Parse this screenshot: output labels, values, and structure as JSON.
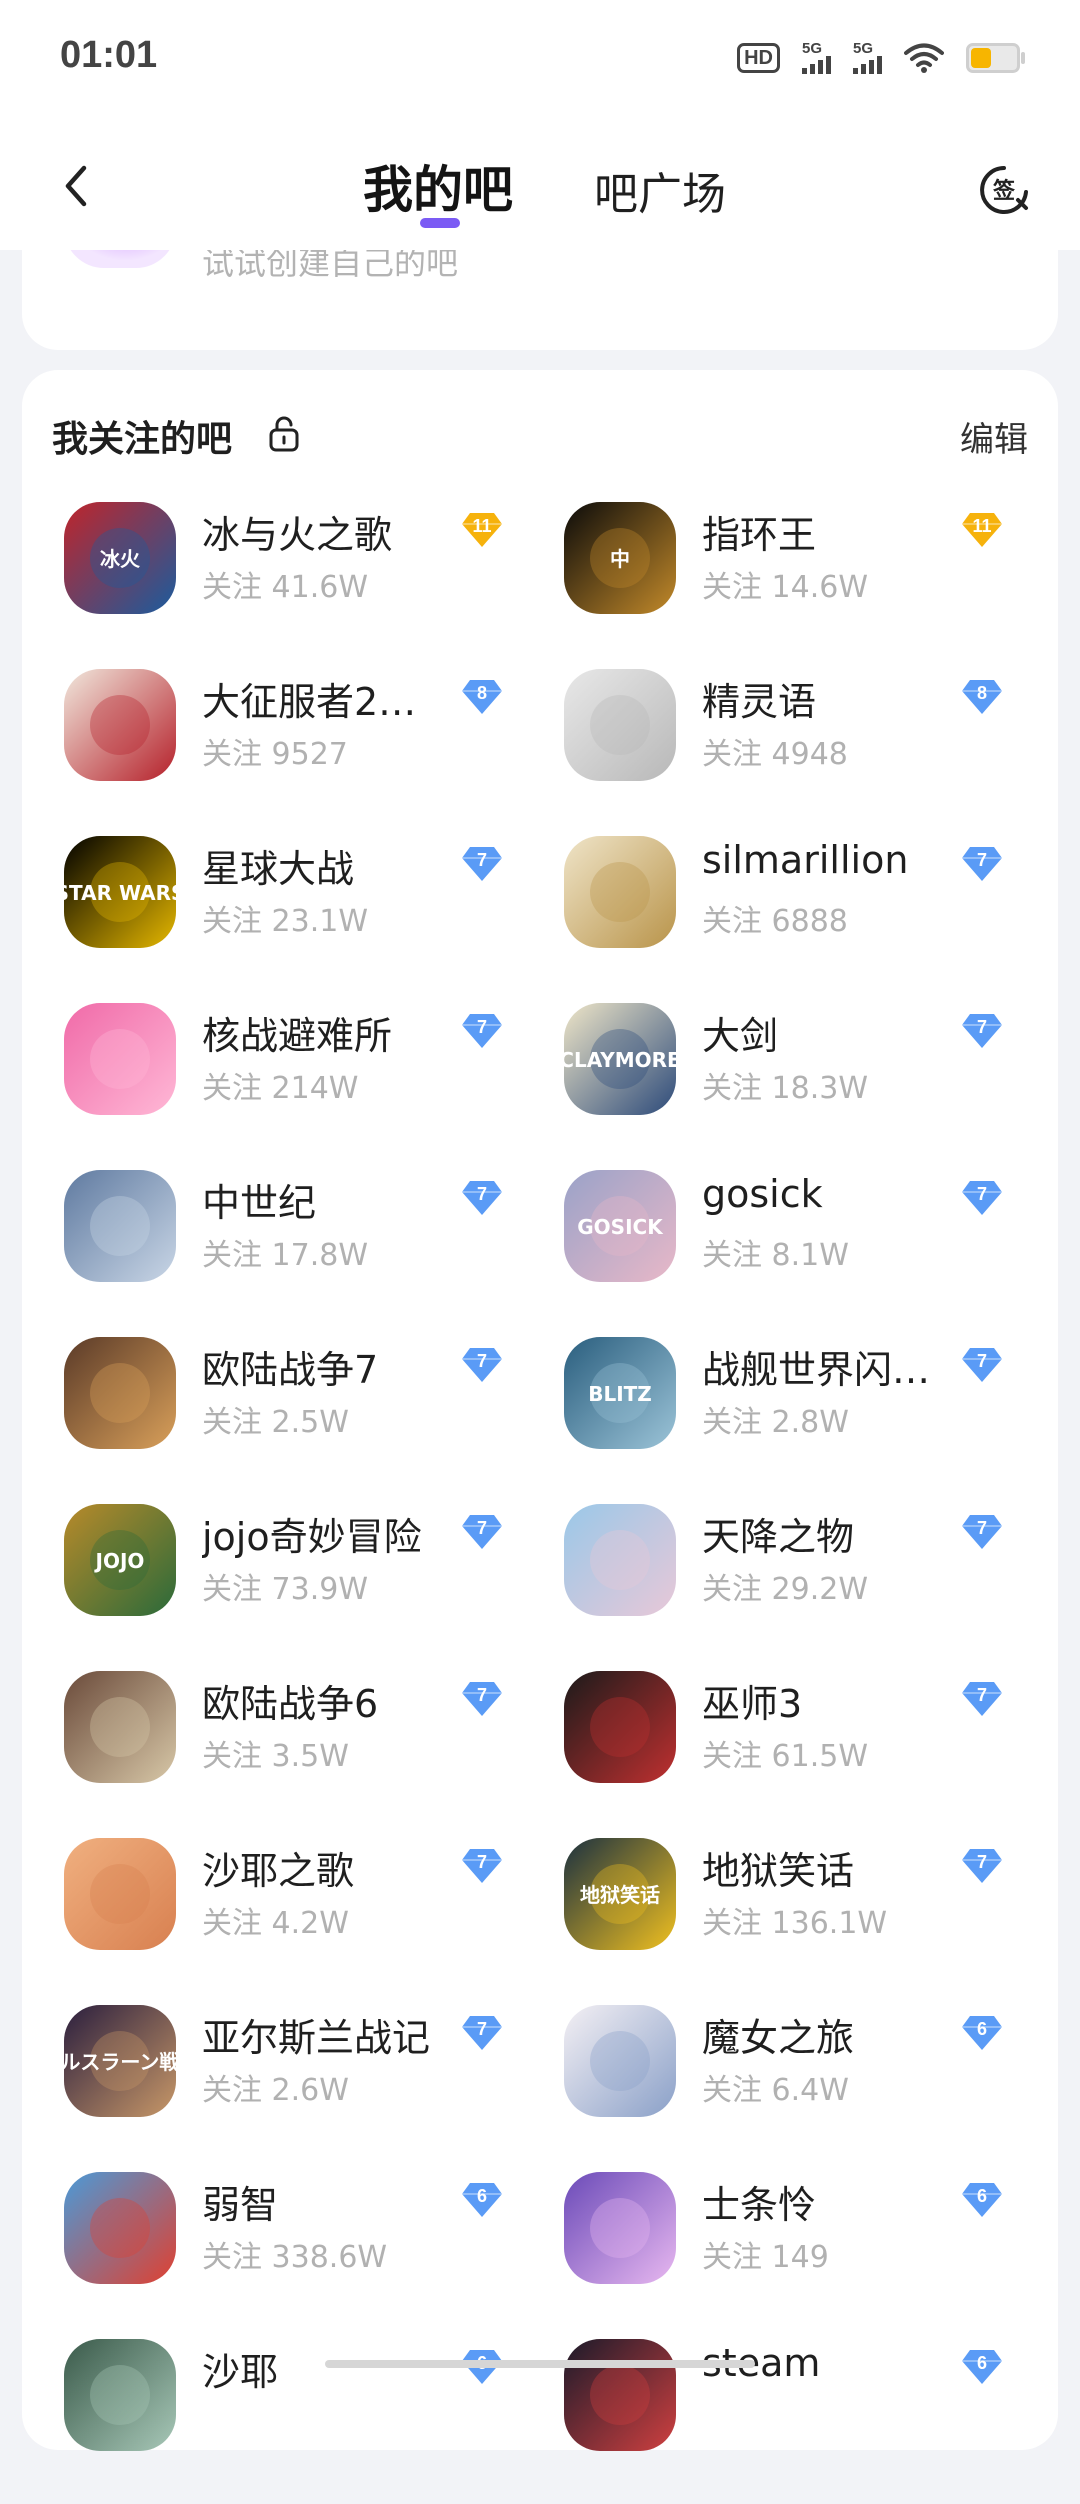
{
  "status_bar": {
    "time": "01:01",
    "hd": "HD",
    "network1": "5G",
    "network2": "5G",
    "battery_level": 0.45,
    "battery_color": "#f7b500"
  },
  "header": {
    "back_icon": "chevron-left-icon",
    "tab_active": "我的吧",
    "tab_inactive": "吧广场",
    "indicator_color": "#7b5bf4",
    "sign_icon": "sign-in-icon",
    "sign_label": "签"
  },
  "top_card": {
    "text": "试试创建自己的吧"
  },
  "section": {
    "title": "我关注的吧",
    "lock_icon": "unlock-icon",
    "edit_label": "编辑"
  },
  "forums": [
    {
      "name": "冰与火之歌",
      "follow": "关注 41.6W",
      "level": "11",
      "badge": "gold",
      "avatar_text": "冰火"
    },
    {
      "name": "指环王",
      "follow": "关注 14.6W",
      "level": "11",
      "badge": "gold",
      "avatar_text": "中"
    },
    {
      "name": "大征服者2…",
      "follow": "关注 9527",
      "level": "8",
      "badge": "blue",
      "avatar_text": ""
    },
    {
      "name": "精灵语",
      "follow": "关注 4948",
      "level": "8",
      "badge": "blue",
      "avatar_text": ""
    },
    {
      "name": "星球大战",
      "follow": "关注 23.1W",
      "level": "7",
      "badge": "blue",
      "avatar_text": "STAR WARS"
    },
    {
      "name": "silmarillion",
      "follow": "关注 6888",
      "level": "7",
      "badge": "blue",
      "avatar_text": ""
    },
    {
      "name": "核战避难所",
      "follow": "关注 214W",
      "level": "7",
      "badge": "blue",
      "avatar_text": ""
    },
    {
      "name": "大剑",
      "follow": "关注 18.3W",
      "level": "7",
      "badge": "blue",
      "avatar_text": "CLAYMORE"
    },
    {
      "name": "中世纪",
      "follow": "关注 17.8W",
      "level": "7",
      "badge": "blue",
      "avatar_text": ""
    },
    {
      "name": "gosick",
      "follow": "关注 8.1W",
      "level": "7",
      "badge": "blue",
      "avatar_text": "GOSICK"
    },
    {
      "name": "欧陆战争7",
      "follow": "关注 2.5W",
      "level": "7",
      "badge": "blue",
      "avatar_text": ""
    },
    {
      "name": "战舰世界闪…",
      "follow": "关注 2.8W",
      "level": "7",
      "badge": "blue",
      "avatar_text": "BLITZ"
    },
    {
      "name": "jojo奇妙冒险",
      "follow": "关注 73.9W",
      "level": "7",
      "badge": "blue",
      "avatar_text": "JOJO"
    },
    {
      "name": "天降之物",
      "follow": "关注 29.2W",
      "level": "7",
      "badge": "blue",
      "avatar_text": ""
    },
    {
      "name": "欧陆战争6",
      "follow": "关注 3.5W",
      "level": "7",
      "badge": "blue",
      "avatar_text": ""
    },
    {
      "name": "巫师3",
      "follow": "关注 61.5W",
      "level": "7",
      "badge": "blue",
      "avatar_text": ""
    },
    {
      "name": "沙耶之歌",
      "follow": "关注 4.2W",
      "level": "7",
      "badge": "blue",
      "avatar_text": ""
    },
    {
      "name": "地狱笑话",
      "follow": "关注 136.1W",
      "level": "7",
      "badge": "blue",
      "avatar_text": "地狱笑话"
    },
    {
      "name": "亚尔斯兰战记",
      "follow": "关注 2.6W",
      "level": "7",
      "badge": "blue",
      "avatar_text": "アルスラーン戦記"
    },
    {
      "name": "魔女之旅",
      "follow": "关注 6.4W",
      "level": "6",
      "badge": "blue",
      "avatar_text": ""
    },
    {
      "name": "弱智",
      "follow": "关注 338.6W",
      "level": "6",
      "badge": "blue",
      "avatar_text": ""
    },
    {
      "name": "士条怜",
      "follow": "关注 149",
      "level": "6",
      "badge": "blue",
      "avatar_text": ""
    },
    {
      "name": "沙耶",
      "follow": "",
      "level": "6",
      "badge": "blue",
      "avatar_text": ""
    },
    {
      "name": "steam",
      "follow": "",
      "level": "6",
      "badge": "blue",
      "avatar_text": ""
    }
  ],
  "badge_colors": {
    "gold": "#f6b20c",
    "blue": "#5a9bf6"
  }
}
